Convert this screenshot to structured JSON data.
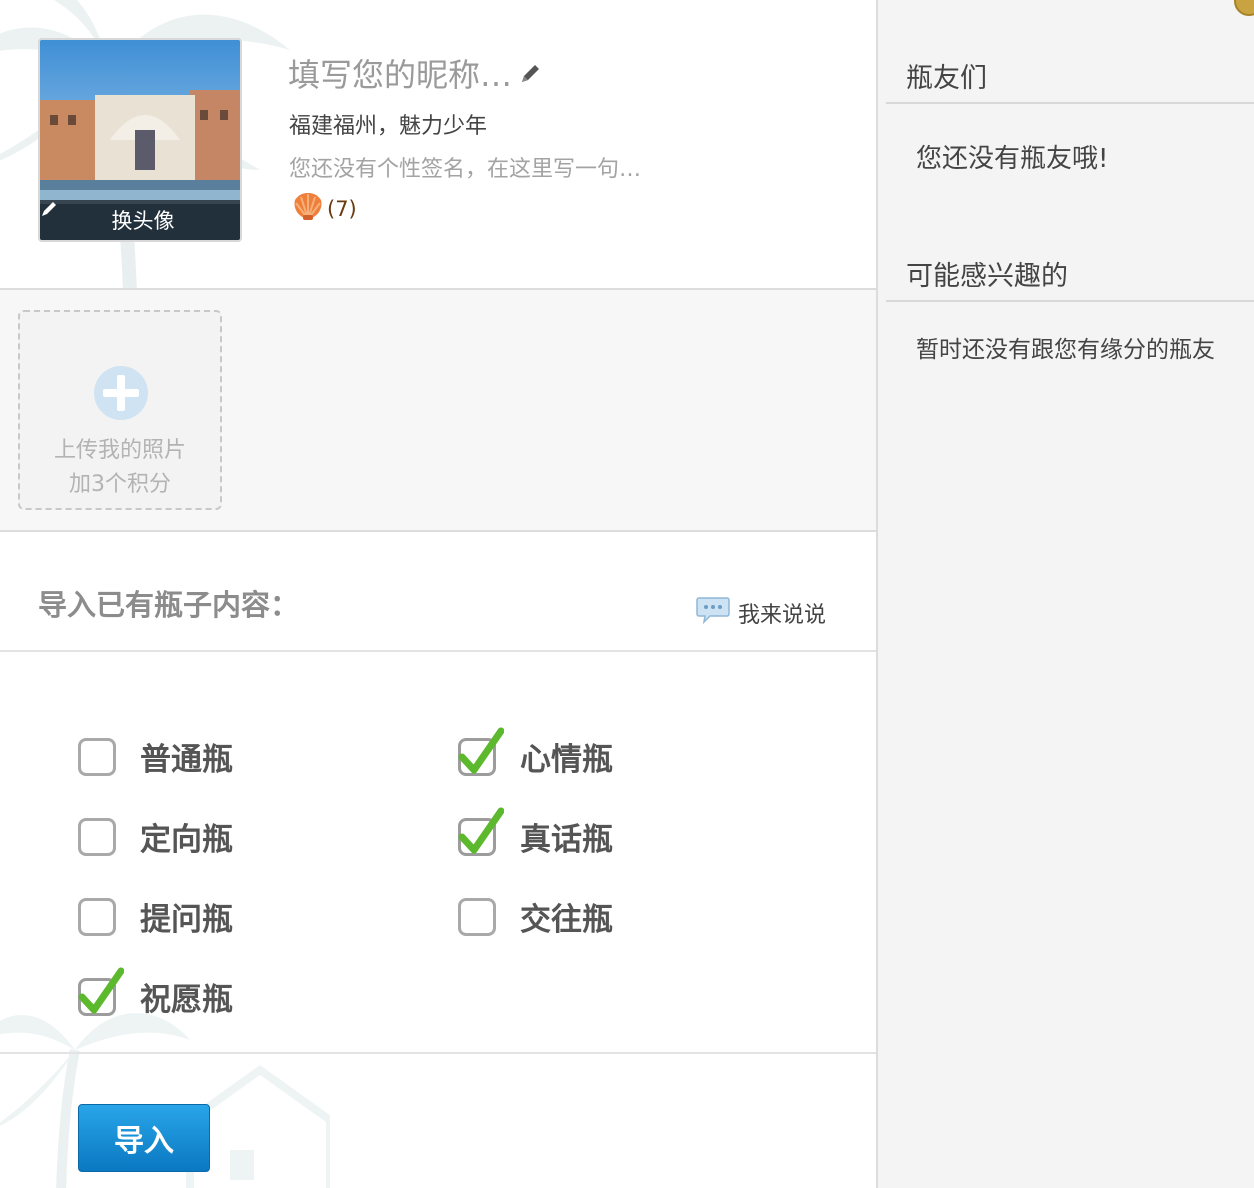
{
  "profile": {
    "nickname": "填写您的昵称…",
    "location": "福建福州，魅力少年",
    "signature": "您还没有个性签名，在这里写一句…",
    "shell_count": "(7)",
    "avatar_change_label": "换头像"
  },
  "upload": {
    "line1": "上传我的照片",
    "line2": "加3个积分"
  },
  "import": {
    "title": "导入已有瓶子内容：",
    "speak_label": "我来说说",
    "options": [
      {
        "label": "普通瓶",
        "checked": false
      },
      {
        "label": "心情瓶",
        "checked": true
      },
      {
        "label": "定向瓶",
        "checked": false
      },
      {
        "label": "真话瓶",
        "checked": true
      },
      {
        "label": "提问瓶",
        "checked": false
      },
      {
        "label": "交往瓶",
        "checked": false
      },
      {
        "label": "祝愿瓶",
        "checked": true
      }
    ],
    "button_label": "导入"
  },
  "sidebar": {
    "friends_title": "瓶友们",
    "friends_empty": "您还没有瓶友哦!",
    "interest_title": "可能感兴趣的",
    "interest_empty": "暂时还没有跟您有缘分的瓶友"
  },
  "colors": {
    "accent_blue": "#1a8fd8",
    "check_green": "#5cb82d",
    "sidebar_bg": "#f4f4f4"
  },
  "icons": [
    "pencil-icon",
    "shell-icon",
    "plus-icon",
    "speech-bubble-icon",
    "checkmark-icon"
  ]
}
